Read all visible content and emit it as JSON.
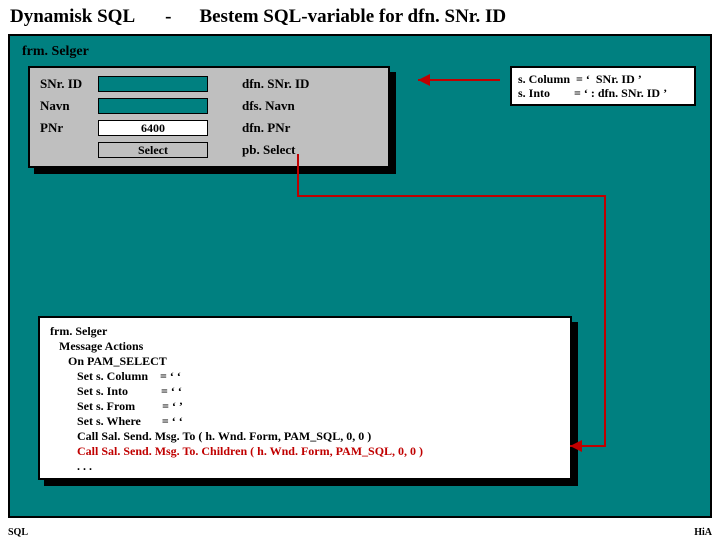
{
  "title": {
    "left": "Dynamisk SQL",
    "dash": "-",
    "right": "Bestem SQL-variable for dfn. SNr. ID"
  },
  "form": {
    "caption": "frm. Selger",
    "rows": [
      {
        "label": "SNr. ID",
        "value": "",
        "name": "dfn. SNr. ID"
      },
      {
        "label": "Navn",
        "value": "",
        "name": "dfs. Navn"
      },
      {
        "label": "PNr",
        "value": "6400",
        "name": "dfn. PNr"
      }
    ],
    "selectButton": "Select",
    "selectName": "pb. Select"
  },
  "info": {
    "line1": "s. Column  = ‘  SNr. ID ’",
    "line2": "s. Into        = ‘ : dfn. SNr. ID ’"
  },
  "code": {
    "l1": "frm. Selger",
    "l2": "   Message Actions",
    "l3": "      On PAM_SELECT",
    "l4": "         Set s. Column    = ‘ ‘",
    "l5": "         Set s. Into           = ‘ ‘",
    "l6": "         Set s. From         = ‘ ’",
    "l7": "         Set s. Where       = ‘ ‘",
    "l8": "         Call Sal. Send. Msg. To ( h. Wnd. Form, PAM_SQL, 0, 0 )",
    "l9": "         Call Sal. Send. Msg. To. Children ( h. Wnd. Form, PAM_SQL, 0, 0 )",
    "l10": "         . . ."
  },
  "footer": {
    "left": "SQL",
    "right": "HiA"
  }
}
